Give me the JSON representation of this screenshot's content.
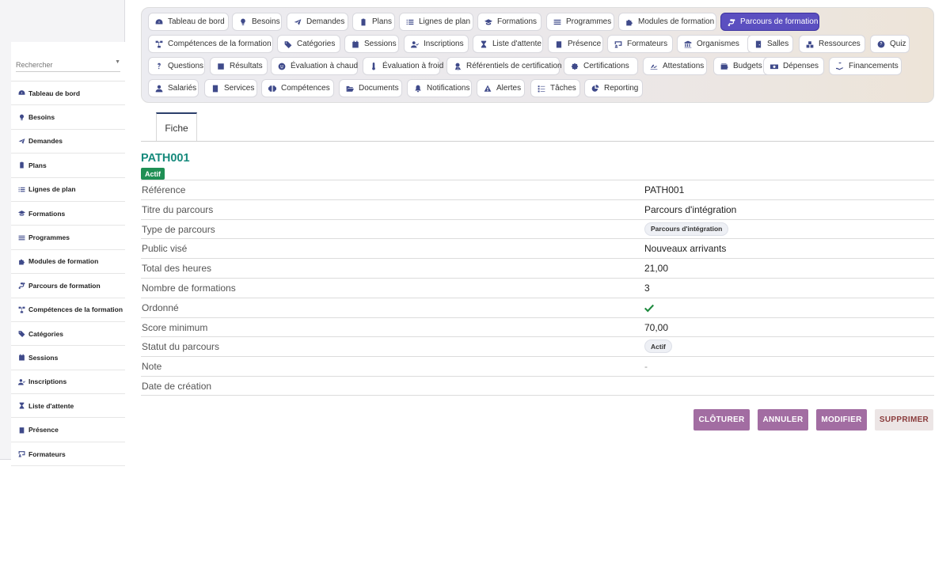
{
  "sidebar": {
    "search_placeholder": "Rechercher",
    "items": [
      {
        "label": "Tableau de bord",
        "icon": "dashboard-icon"
      },
      {
        "label": "Besoins",
        "icon": "lightbulb-icon"
      },
      {
        "label": "Demandes",
        "icon": "paper-plane-icon"
      },
      {
        "label": "Plans",
        "icon": "clipboard-icon"
      },
      {
        "label": "Lignes de plan",
        "icon": "list-icon"
      },
      {
        "label": "Formations",
        "icon": "graduation-cap-icon"
      },
      {
        "label": "Programmes",
        "icon": "bars-icon"
      },
      {
        "label": "Modules de formation",
        "icon": "puzzle-icon"
      },
      {
        "label": "Parcours de formation",
        "icon": "route-icon"
      },
      {
        "label": "Compétences de la formation",
        "icon": "sitemap-icon"
      },
      {
        "label": "Catégories",
        "icon": "tags-icon"
      },
      {
        "label": "Sessions",
        "icon": "calendar-icon"
      },
      {
        "label": "Inscriptions",
        "icon": "user-check-icon"
      },
      {
        "label": "Liste d'attente",
        "icon": "hourglass-icon"
      },
      {
        "label": "Présence",
        "icon": "clipboard-check-icon"
      },
      {
        "label": "Formateurs",
        "icon": "chalkboard-teacher-icon"
      }
    ]
  },
  "tabs": [
    {
      "label": "Tableau de bord",
      "icon": "dashboard-icon"
    },
    {
      "label": "Besoins",
      "icon": "lightbulb-icon"
    },
    {
      "label": "Demandes",
      "icon": "paper-plane-icon"
    },
    {
      "label": "Plans",
      "icon": "clipboard-icon"
    },
    {
      "label": "Lignes de plan",
      "icon": "list-icon"
    },
    {
      "label": "Formations",
      "icon": "graduation-cap-icon"
    },
    {
      "label": "Programmes",
      "icon": "bars-icon"
    },
    {
      "label": "Modules de formation",
      "icon": "puzzle-icon"
    },
    {
      "label": "Parcours de formation",
      "icon": "route-icon",
      "active": true
    },
    {
      "label": "Compétences de la formation",
      "icon": "sitemap-icon"
    },
    {
      "label": "Catégories",
      "icon": "tags-icon"
    },
    {
      "label": "Sessions",
      "icon": "calendar-icon"
    },
    {
      "label": "Inscriptions",
      "icon": "user-check-icon"
    },
    {
      "label": "Liste d'attente",
      "icon": "hourglass-icon"
    },
    {
      "label": "Présence",
      "icon": "clipboard-check-icon"
    },
    {
      "label": "Formateurs",
      "icon": "chalkboard-teacher-icon"
    },
    {
      "label": "Organismes",
      "icon": "building-icon"
    },
    {
      "label": "Salles",
      "icon": "door-icon"
    },
    {
      "label": "Ressources",
      "icon": "boxes-icon"
    },
    {
      "label": "Quiz",
      "icon": "question-circle-icon"
    },
    {
      "label": "Questions",
      "icon": "question-icon"
    },
    {
      "label": "Résultats",
      "icon": "poll-icon"
    },
    {
      "label": "Évaluation à chaud",
      "icon": "smile-icon"
    },
    {
      "label": "Évaluation à froid",
      "icon": "thermometer-icon"
    },
    {
      "label": "Référentiels de certification",
      "icon": "award-icon"
    },
    {
      "label": "Certifications",
      "icon": "certificate-icon"
    },
    {
      "label": "Attestations",
      "icon": "signature-icon"
    },
    {
      "label": "Budgets",
      "icon": "wallet-icon"
    },
    {
      "label": "Dépenses",
      "icon": "money-bill-icon"
    },
    {
      "label": "Financements",
      "icon": "hand-holding-icon"
    },
    {
      "label": "Salariés",
      "icon": "user-icon"
    },
    {
      "label": "Services",
      "icon": "building-column-icon"
    },
    {
      "label": "Compétences",
      "icon": "brain-icon"
    },
    {
      "label": "Documents",
      "icon": "folder-open-icon"
    },
    {
      "label": "Notifications",
      "icon": "bell-icon"
    },
    {
      "label": "Alertes",
      "icon": "warning-icon"
    },
    {
      "label": "Tâches",
      "icon": "tasks-icon"
    },
    {
      "label": "Reporting",
      "icon": "pie-chart-icon"
    }
  ],
  "view_tab": "Fiche",
  "record": {
    "title": "PATH001",
    "status_badge": "Actif",
    "fields": [
      {
        "label": "Référence",
        "value": "PATH001"
      },
      {
        "label": "Titre du parcours",
        "value": "Parcours d'intégration"
      },
      {
        "label": "Type de parcours",
        "chip": "Parcours d'intégration"
      },
      {
        "label": "Public visé",
        "value": "Nouveaux arrivants"
      },
      {
        "label": "Total des heures",
        "value": "21,00"
      },
      {
        "label": "Nombre de formations",
        "value": "3"
      },
      {
        "label": "Ordonné",
        "check": true
      },
      {
        "label": "Score minimum",
        "value": "70,00"
      },
      {
        "label": "Statut du parcours",
        "chip": "Actif"
      },
      {
        "label": "Note",
        "value": "-"
      },
      {
        "label": "Date de création",
        "value": ""
      }
    ]
  },
  "actions": {
    "close": "CLÔTURER",
    "cancel": "ANNULER",
    "edit": "MODIFIER",
    "delete": "SUPPRIMER"
  },
  "colors": {
    "active_tab": "#5b4fc0",
    "title": "#168a7c",
    "badge": "#1f8f54",
    "action_button": "#a26da2",
    "delete_text": "#8a3c3c",
    "check": "#1e8a3e"
  }
}
